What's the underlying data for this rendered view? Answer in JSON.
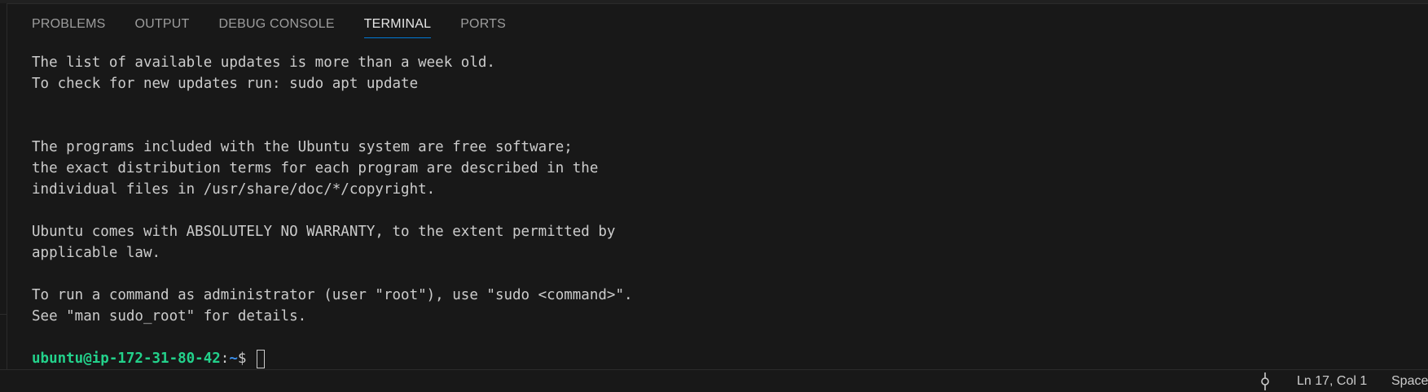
{
  "panel": {
    "tabs": [
      {
        "label": "PROBLEMS",
        "active": false
      },
      {
        "label": "OUTPUT",
        "active": false
      },
      {
        "label": "DEBUG CONSOLE",
        "active": false
      },
      {
        "label": "TERMINAL",
        "active": true
      },
      {
        "label": "PORTS",
        "active": false
      }
    ]
  },
  "terminal": {
    "lines": [
      "The list of available updates is more than a week old.",
      "To check for new updates run: sudo apt update",
      "",
      "",
      "The programs included with the Ubuntu system are free software;",
      "the exact distribution terms for each program are described in the",
      "individual files in /usr/share/doc/*/copyright.",
      "",
      "Ubuntu comes with ABSOLUTELY NO WARRANTY, to the extent permitted by",
      "applicable law.",
      "",
      "To run a command as administrator (user \"root\"), use \"sudo <command>\".",
      "See \"man sudo_root\" for details.",
      ""
    ],
    "prompt": {
      "user_host": "ubuntu@ip-172-31-80-42",
      "separator": ":",
      "path": "~",
      "symbol": "$ "
    }
  },
  "status_bar": {
    "icon": "source-control-commit-icon",
    "cursor_position": "Ln 17, Col 1",
    "indentation": "Spaces"
  },
  "colors": {
    "background": "#181818",
    "active_tab_underline": "#0078d4",
    "prompt_user": "#23d18b",
    "prompt_path": "#3b8eea"
  }
}
